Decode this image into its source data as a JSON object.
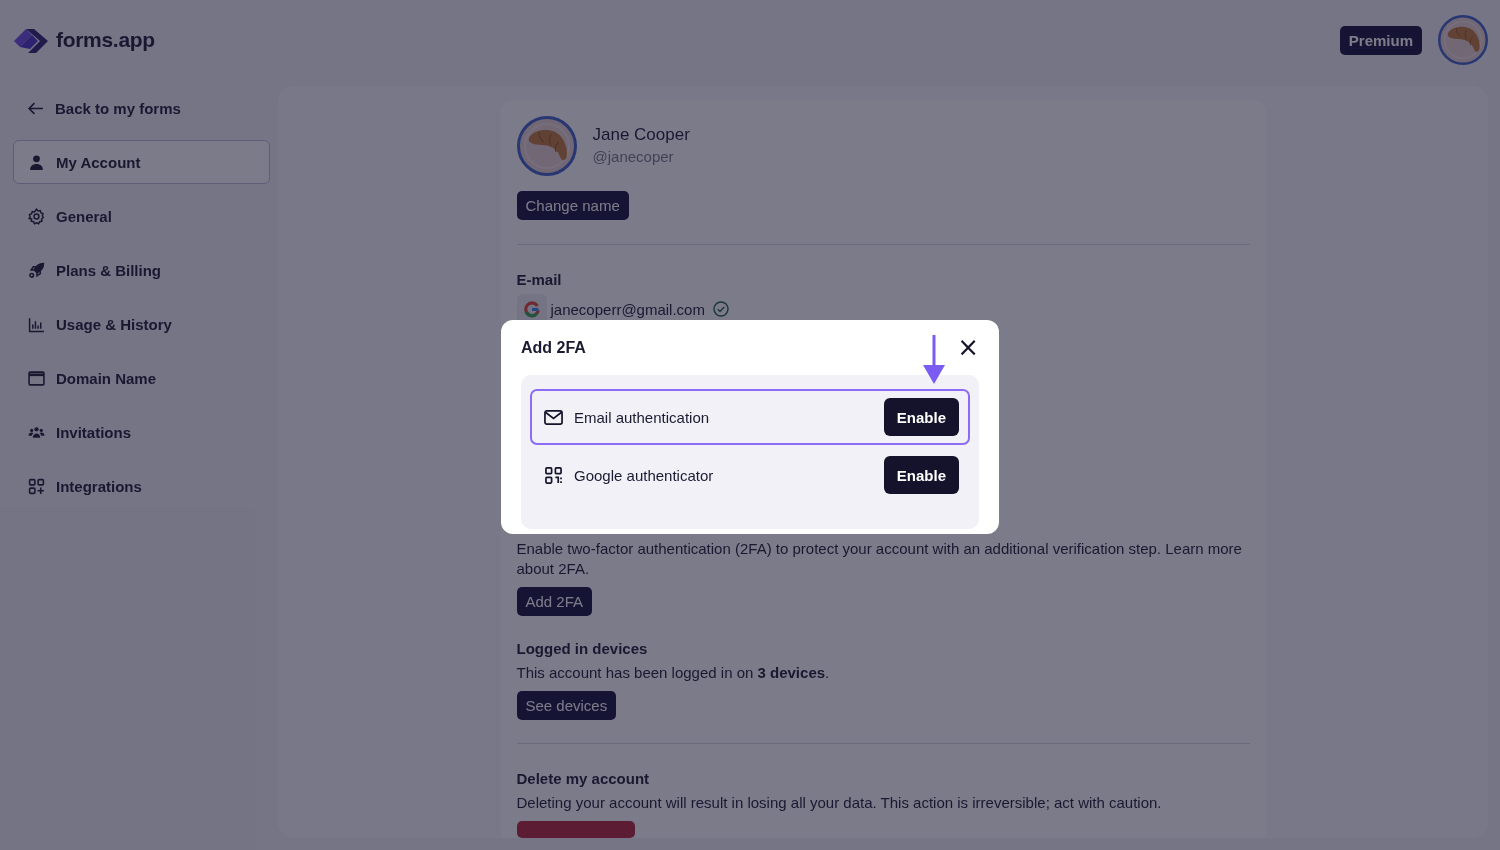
{
  "brand": {
    "name": "forms.app"
  },
  "header": {
    "plan_badge": "Premium"
  },
  "sidebar": {
    "back_link": "Back to my forms",
    "items": [
      {
        "label": "My Account",
        "selected": true
      },
      {
        "label": "General",
        "selected": false
      },
      {
        "label": "Plans & Billing",
        "selected": false
      },
      {
        "label": "Usage & History",
        "selected": false
      },
      {
        "label": "Domain Name",
        "selected": false
      },
      {
        "label": "Invitations",
        "selected": false
      },
      {
        "label": "Integrations",
        "selected": false
      }
    ]
  },
  "profile": {
    "name": "Jane Cooper",
    "username": "@janecoper",
    "button": "Change name"
  },
  "email": {
    "heading": "E-mail",
    "address": "janecoperr@gmail.com",
    "verified": true
  },
  "two_factor": {
    "description": "Enable two-factor authentication (2FA) to protect your account with an additional verification step. Learn more about 2FA.",
    "button": "Add 2FA"
  },
  "devices": {
    "heading": "Logged in devices",
    "text": "This account has been logged in on **3 devices**.",
    "button": "See devices"
  },
  "delete": {
    "heading": "Delete my account",
    "text": "Deleting your account will result in losing all your data. This action is irreversible; act with caution."
  },
  "modal": {
    "title": "Add 2FA",
    "close": "×",
    "options": [
      {
        "kind": "email",
        "label": "Email authentication",
        "button": "Enable",
        "selected": true
      },
      {
        "kind": "authenticator",
        "label": "Google authenticator",
        "button": "Enable",
        "selected": false
      }
    ]
  }
}
